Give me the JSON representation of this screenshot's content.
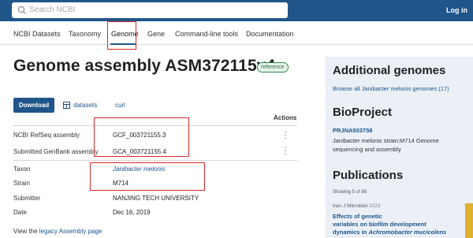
{
  "header": {
    "search_placeholder": "Search NCBI",
    "login_label": "Log in"
  },
  "nav": {
    "tabs": [
      {
        "label": "NCBI Datasets"
      },
      {
        "label": "Taxonomy"
      },
      {
        "label": "Genome"
      },
      {
        "label": "Gene"
      },
      {
        "label": "Command-line tools"
      },
      {
        "label": "Documentation"
      }
    ],
    "active_tab": "Genome"
  },
  "main": {
    "title": "Genome assembly ASM372115v4",
    "badge": "reference",
    "buttons": {
      "download": "Download",
      "datasets": "datasets",
      "curl": "curl"
    },
    "actions_header": "Actions",
    "rows": [
      {
        "label": "NCBI RefSeq assembly",
        "value": "GCF_003721155.3"
      },
      {
        "label": "Submitted GenBank assembly",
        "value": "GCA_003721155.4"
      },
      {
        "label": "Taxon",
        "value": "Janibacter melonis"
      },
      {
        "label": "Strain",
        "value": "M714"
      },
      {
        "label": "Submitter",
        "value": "NANJING TECH UNIVERSITY"
      },
      {
        "label": "Date",
        "value": "Dec 16, 2019"
      }
    ],
    "footer": {
      "prefix": "View the",
      "link": "legacy Assembly page"
    }
  },
  "sidebar": {
    "additional_genomes": {
      "heading": "Additional genomes",
      "link": "Browse all Janibacter melonis genomes (17)"
    },
    "bioproject": {
      "heading": "BioProject",
      "id": "PRJNA503758",
      "description": "Janibacter melonis strain:M714 Genome sequencing and assembly"
    },
    "publications": {
      "heading": "Publications",
      "count": "Showing 5 of 86",
      "journal": "Iran J Microbiol",
      "year": "2023",
      "title_prefix": "Effects of genetic",
      "title_mid": "variables on biofilm development",
      "title_end_plain": "dynamics in ",
      "title_end_italic": "Achromobacter mucicolens"
    }
  },
  "colors": {
    "header_bg": "#20558a",
    "link": "#20558a",
    "highlight_box": "#d62a2a",
    "panel_bg": "#eaf0f6"
  }
}
